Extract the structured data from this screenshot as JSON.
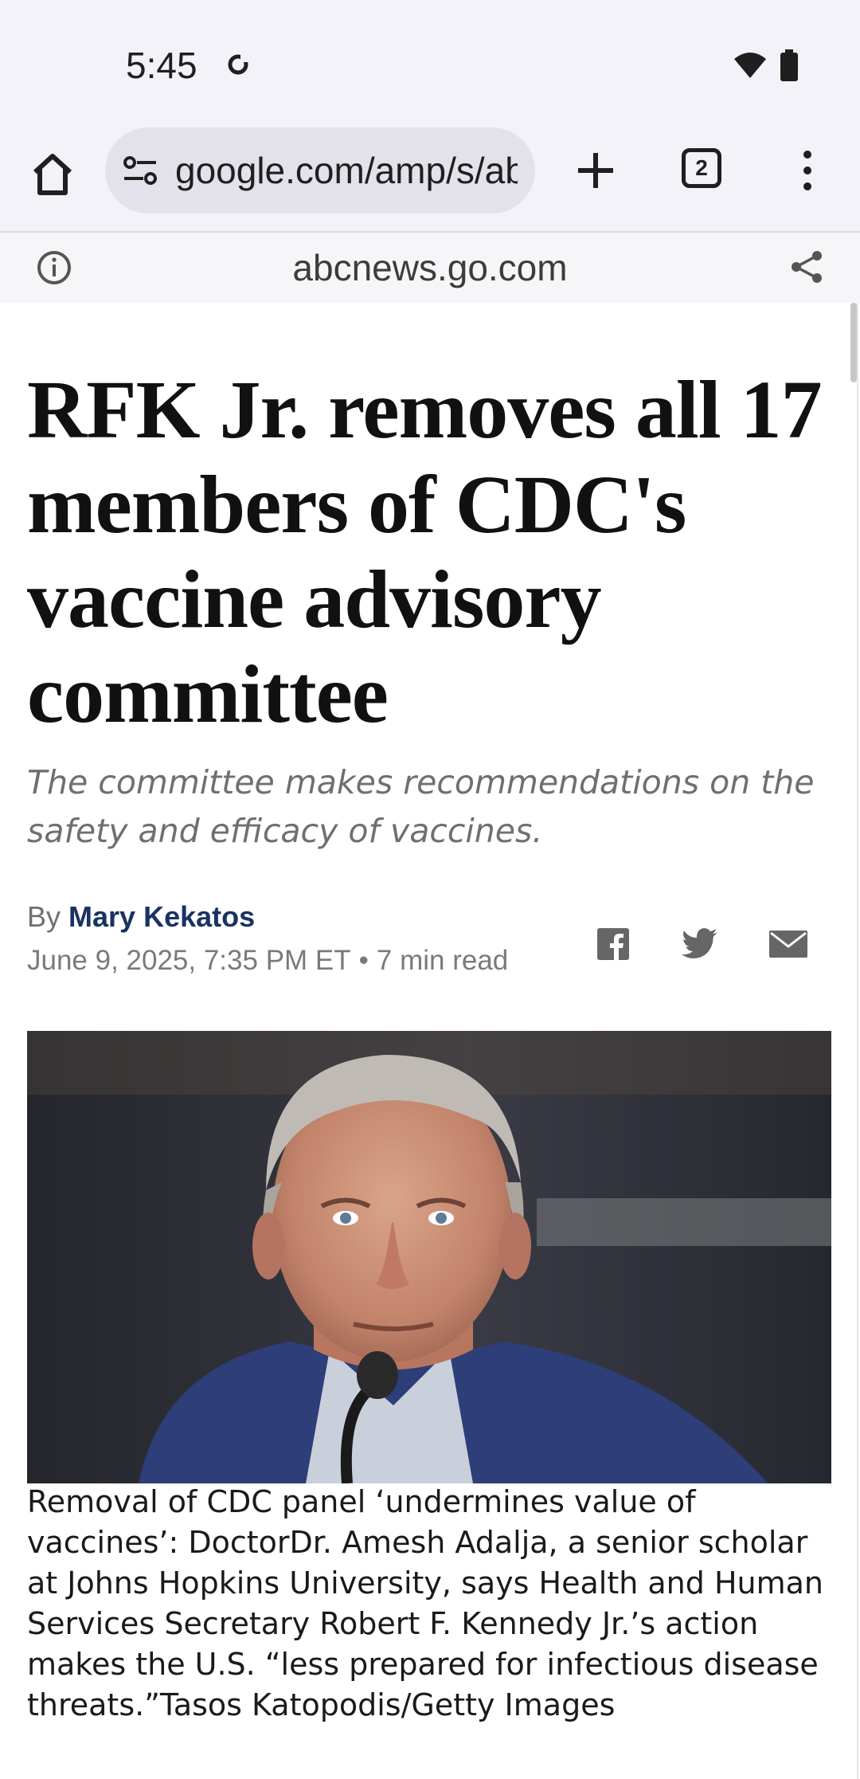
{
  "status_bar": {
    "time": "5:45"
  },
  "browser": {
    "url": "google.com/amp/s/abcnews.go.com",
    "tab_count": "2",
    "amp_domain": "abcnews.go.com"
  },
  "article": {
    "headline": "RFK Jr. removes all 17 members of CDC's vaccine advisory committee",
    "subheading": "The committee makes recommendations on the safety and efficacy of vaccines.",
    "byline_prefix": "By",
    "author": "Mary Kekatos",
    "date": "June 9, 2025, 7:35 PM ET",
    "separator": "•",
    "read_time": "7 min read",
    "caption": "Removal of CDC panel ‘undermines value of vaccines’: DoctorDr. Amesh Adalja, a senior scholar at Johns Hopkins University, says Health and Human Services Secretary Robert F. Kennedy Jr.’s action makes the U.S. “less prepared for infectious disease threats.”Tasos Katopodis/Getty Images"
  },
  "colors": {
    "author_link": "#1a3263",
    "chrome_bg": "#f3f2f8"
  }
}
